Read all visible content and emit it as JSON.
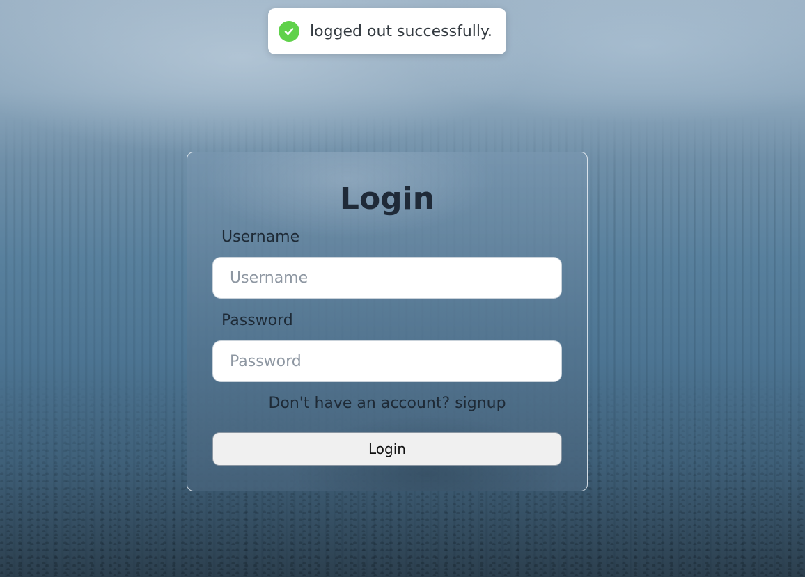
{
  "toast": {
    "message": "logged out successfully.",
    "icon": "check-circle-icon",
    "icon_color": "#5fd14a"
  },
  "login_form": {
    "title": "Login",
    "username_label": "Username",
    "username_placeholder": "Username",
    "username_value": "",
    "password_label": "Password",
    "password_placeholder": "Password",
    "password_value": "",
    "signup_prompt": "Don't have an account?",
    "signup_link": "signup",
    "submit_label": "Login"
  }
}
